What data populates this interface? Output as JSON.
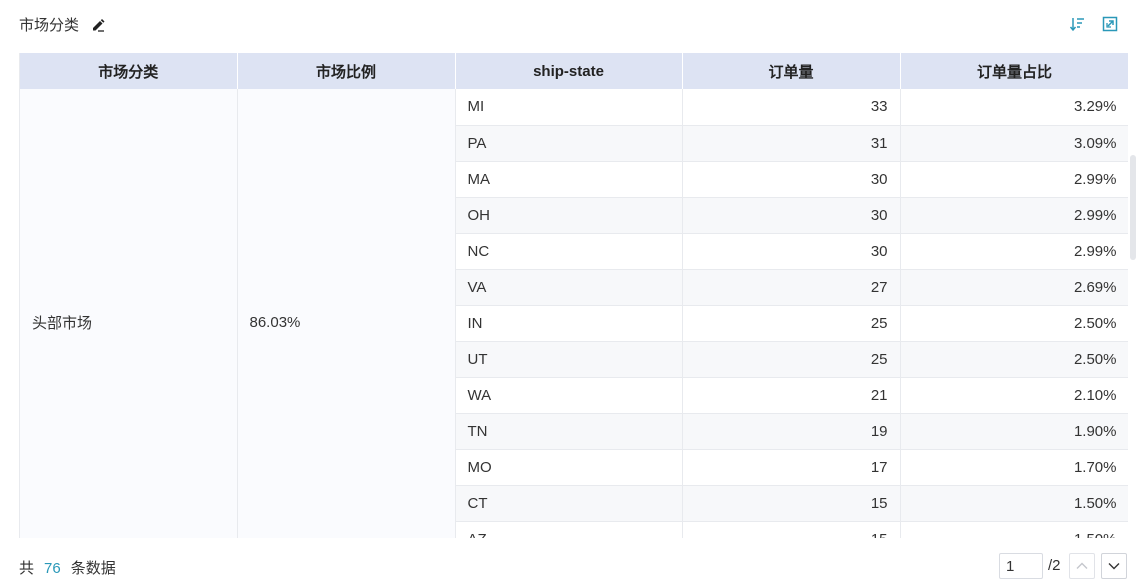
{
  "header": {
    "title": "市场分类"
  },
  "table": {
    "columns": [
      "市场分类",
      "市场比例",
      "ship-state",
      "订单量",
      "订单量占比"
    ],
    "group": {
      "category": "头部市场",
      "ratio": "86.03%"
    },
    "rows": [
      {
        "state": "MI",
        "orders": "33",
        "share": "3.29%"
      },
      {
        "state": "PA",
        "orders": "31",
        "share": "3.09%"
      },
      {
        "state": "MA",
        "orders": "30",
        "share": "2.99%"
      },
      {
        "state": "OH",
        "orders": "30",
        "share": "2.99%"
      },
      {
        "state": "NC",
        "orders": "30",
        "share": "2.99%"
      },
      {
        "state": "VA",
        "orders": "27",
        "share": "2.69%"
      },
      {
        "state": "IN",
        "orders": "25",
        "share": "2.50%"
      },
      {
        "state": "UT",
        "orders": "25",
        "share": "2.50%"
      },
      {
        "state": "WA",
        "orders": "21",
        "share": "2.10%"
      },
      {
        "state": "TN",
        "orders": "19",
        "share": "1.90%"
      },
      {
        "state": "MO",
        "orders": "17",
        "share": "1.70%"
      },
      {
        "state": "CT",
        "orders": "15",
        "share": "1.50%"
      },
      {
        "state": "AZ",
        "orders": "15",
        "share": "1.50%"
      }
    ]
  },
  "footer": {
    "total_prefix": "共",
    "total_count": "76",
    "total_suffix": "条数据",
    "page_current": "1",
    "page_total": "/2"
  },
  "colors": {
    "accent": "#2a98b8",
    "header_bg": "#dde3f3"
  },
  "icons": [
    "edit-icon",
    "sort-icon",
    "expand-icon",
    "chevron-up-icon",
    "chevron-down-icon"
  ]
}
